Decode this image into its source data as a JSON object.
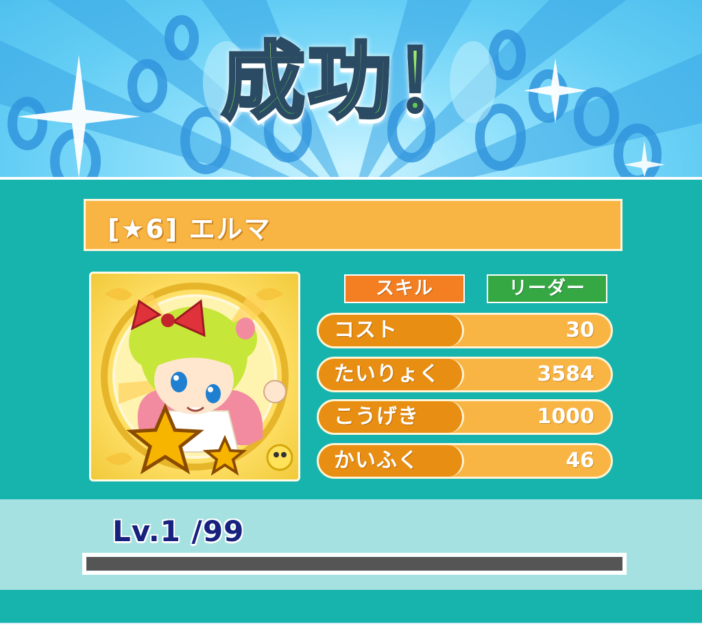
{
  "header": {
    "title": "成功！"
  },
  "unit": {
    "name": "[★6] エルマ",
    "rarity_stars": 6,
    "portrait_icon": "elma-portrait-icon"
  },
  "tags": {
    "skill": "スキル",
    "leader": "リーダー"
  },
  "stats": [
    {
      "label": "コスト",
      "value": "30"
    },
    {
      "label": "たいりょく",
      "value": "3584"
    },
    {
      "label": "こうげき",
      "value": "1000"
    },
    {
      "label": "かいふく",
      "value": "46"
    }
  ],
  "level": {
    "text": "Lv.1 /99",
    "current": 1,
    "max": 99,
    "exp_progress": 0
  },
  "colors": {
    "panel": "#17b4ae",
    "name_bar": "#f9b544",
    "stat_label": "#e88e12",
    "skill": "#f37f22",
    "leader": "#35a844",
    "level_text": "#17217e",
    "exp_track": "#555555"
  }
}
